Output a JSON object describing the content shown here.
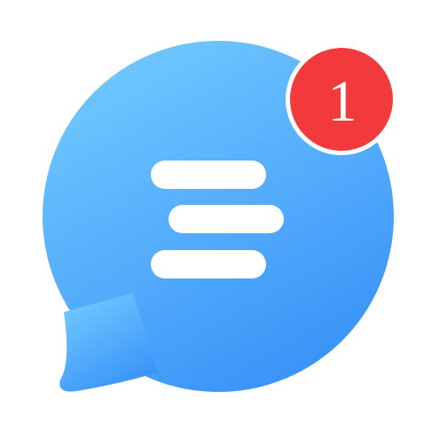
{
  "app_icon": {
    "icon": "chat-bubble-icon",
    "glyph": "message-lines-icon",
    "gradient": [
      "#6ec6ff",
      "#3a93f7"
    ],
    "line_color": "#ffffff"
  },
  "notification_badge": {
    "count": "1",
    "color": "#f23a3c",
    "text_color": "#ffffff"
  }
}
